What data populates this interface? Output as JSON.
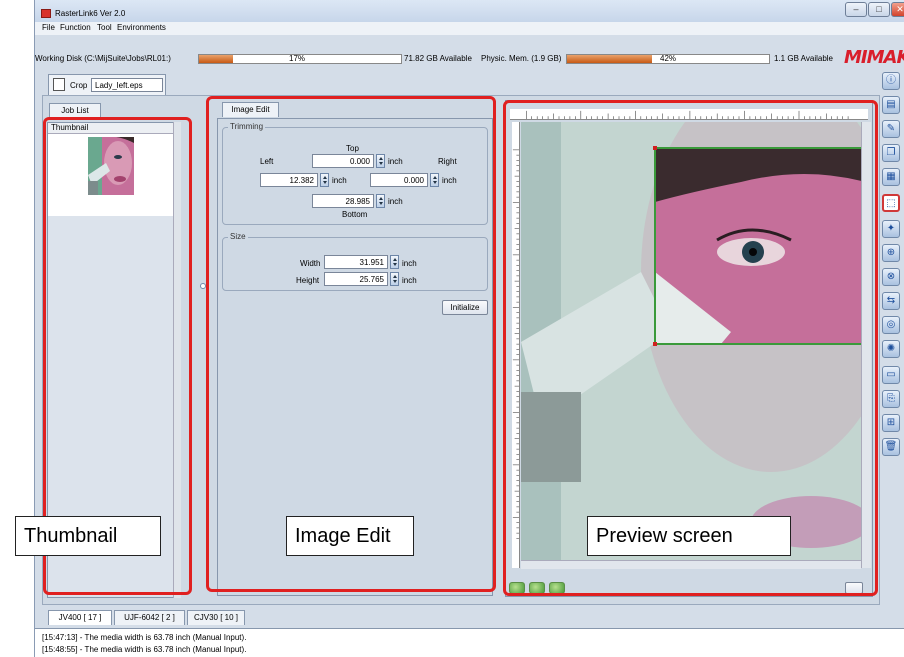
{
  "window": {
    "title": "RasterLink6 Ver 2.0",
    "minimize": "–",
    "maximize": "□",
    "close": "✕"
  },
  "menu": [
    "File",
    "Function",
    "Tool",
    "Environments"
  ],
  "status": {
    "disk_label": "Working Disk (C:\\MijSuite\\Jobs\\RL01:)",
    "disk_percent_text": "17%",
    "disk_fill": 0.17,
    "disk_available": "71.82 GB Available",
    "mem_label": "Physic. Mem. (1.9 GB)",
    "mem_percent_text": "42%",
    "mem_fill": 0.42,
    "mem_available": "1.1 GB Available",
    "logo": "MIMAKI"
  },
  "job_tab": {
    "function": "Crop",
    "filename": "Lady_left.eps"
  },
  "left_panel": {
    "tab": "Job List",
    "header": "Thumbnail"
  },
  "image_edit": {
    "tab": "Image Edit",
    "trimming": {
      "legend": "Trimming",
      "top_label": "Top",
      "left_label": "Left",
      "right_label": "Right",
      "bottom_label": "Bottom",
      "top_value": "0.000",
      "left_value": "12.382",
      "right_value": "0.000",
      "bottom_value": "28.985",
      "unit": "inch"
    },
    "size": {
      "legend": "Size",
      "width_label": "Width",
      "width_value": "31.951",
      "height_label": "Height",
      "height_value": "25.765",
      "unit": "inch"
    },
    "initialize_label": "Initialize"
  },
  "bottom_tabs": [
    "JV400 [ 17 ]",
    "UJF-6042 [ 2 ]",
    "CJV30 [ 10 ]"
  ],
  "log": [
    "[15:47:13] - The media width is 63.78 inch (Manual Input).",
    "[15:48:55] - The media width is 63.78 inch (Manual Input)."
  ],
  "callouts": {
    "thumbnail": "Thumbnail",
    "image_edit": "Image Edit",
    "preview": "Preview screen"
  },
  "colors": {
    "highlight": "#e02020",
    "accent_bar": "#c85a14",
    "logo": "#d91e2b",
    "crop_frame": "#3a9a3a"
  },
  "toolbar_icons": [
    "info-icon",
    "job-properties-icon",
    "edit-icon",
    "multiple-copies-icon",
    "layout-icon",
    "crop-icon",
    "composite-icon",
    "rip-icon",
    "print-icon",
    "rip-and-print-icon",
    "color-adjust-icon",
    "color-collection-icon",
    "media-icon",
    "copy-icon",
    "tile-icon",
    "delete-icon"
  ]
}
